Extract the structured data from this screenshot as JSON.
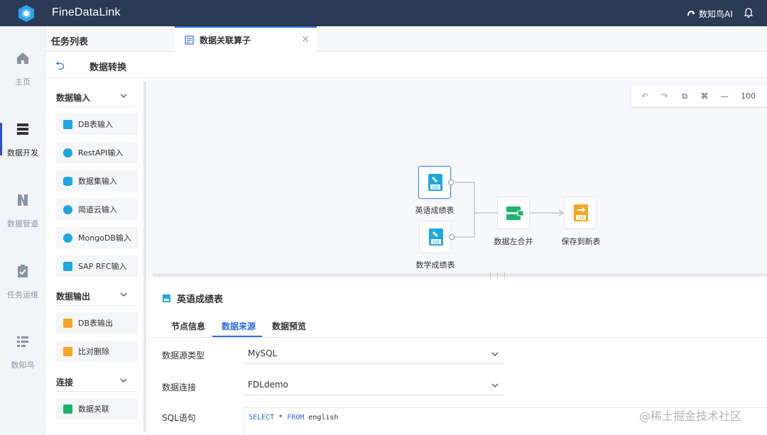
{
  "topbar": {
    "app_title": "FineDataLink",
    "ai_label": "数知鸟AI"
  },
  "leftnav": {
    "items": [
      {
        "label": "主页",
        "icon": "home-icon"
      },
      {
        "label": "数据开发",
        "icon": "database-icon",
        "active": true
      },
      {
        "label": "数据管道",
        "icon": "pipeline-icon"
      },
      {
        "label": "任务运维",
        "icon": "clipboard-icon"
      },
      {
        "label": "数知鸟",
        "icon": "list-icon"
      }
    ]
  },
  "tasklist": {
    "title": "任务列表"
  },
  "tab": {
    "label": "数据关联算子"
  },
  "subheader": {
    "title": "数据转换"
  },
  "operators": {
    "groups": [
      {
        "title": "数据输入",
        "items": [
          "DB表输入",
          "RestAPI输入",
          "数据集输入",
          "简道云输入",
          "MongoDB输入",
          "SAP RFC输入"
        ]
      },
      {
        "title": "数据输出",
        "items": [
          "DB表输出",
          "比对删除"
        ]
      },
      {
        "title": "连接",
        "items": [
          "数据关联"
        ]
      }
    ]
  },
  "toolbar": {
    "zoom": "100"
  },
  "canvas": {
    "nodes": [
      {
        "label": "英语成绩表",
        "badge": "DB"
      },
      {
        "label": "数学成绩表",
        "badge": "DB"
      },
      {
        "label": "数据左合并"
      },
      {
        "label": "保存到新表",
        "badge": "DB"
      }
    ]
  },
  "detail": {
    "title": "英语成绩表",
    "tabs": [
      "节点信息",
      "数据来源",
      "数据预览"
    ],
    "active_tab": "数据来源",
    "fields": {
      "source_type_label": "数据源类型",
      "source_type_value": "MySQL",
      "connection_label": "数据连接",
      "connection_value": "FDLdemo",
      "sql_label": "SQL语句",
      "sql_kw1": "SELECT",
      "sql_star": " * ",
      "sql_kw2": "FROM",
      "sql_table": " english"
    }
  },
  "watermark": "@稀土掘金技术社区",
  "colors": {
    "topbar": "#2b3a55",
    "accent": "#2d6be6",
    "db_blue": "#1ea7e0",
    "join_green": "#1bb46a",
    "save_orange": "#f5a623"
  }
}
